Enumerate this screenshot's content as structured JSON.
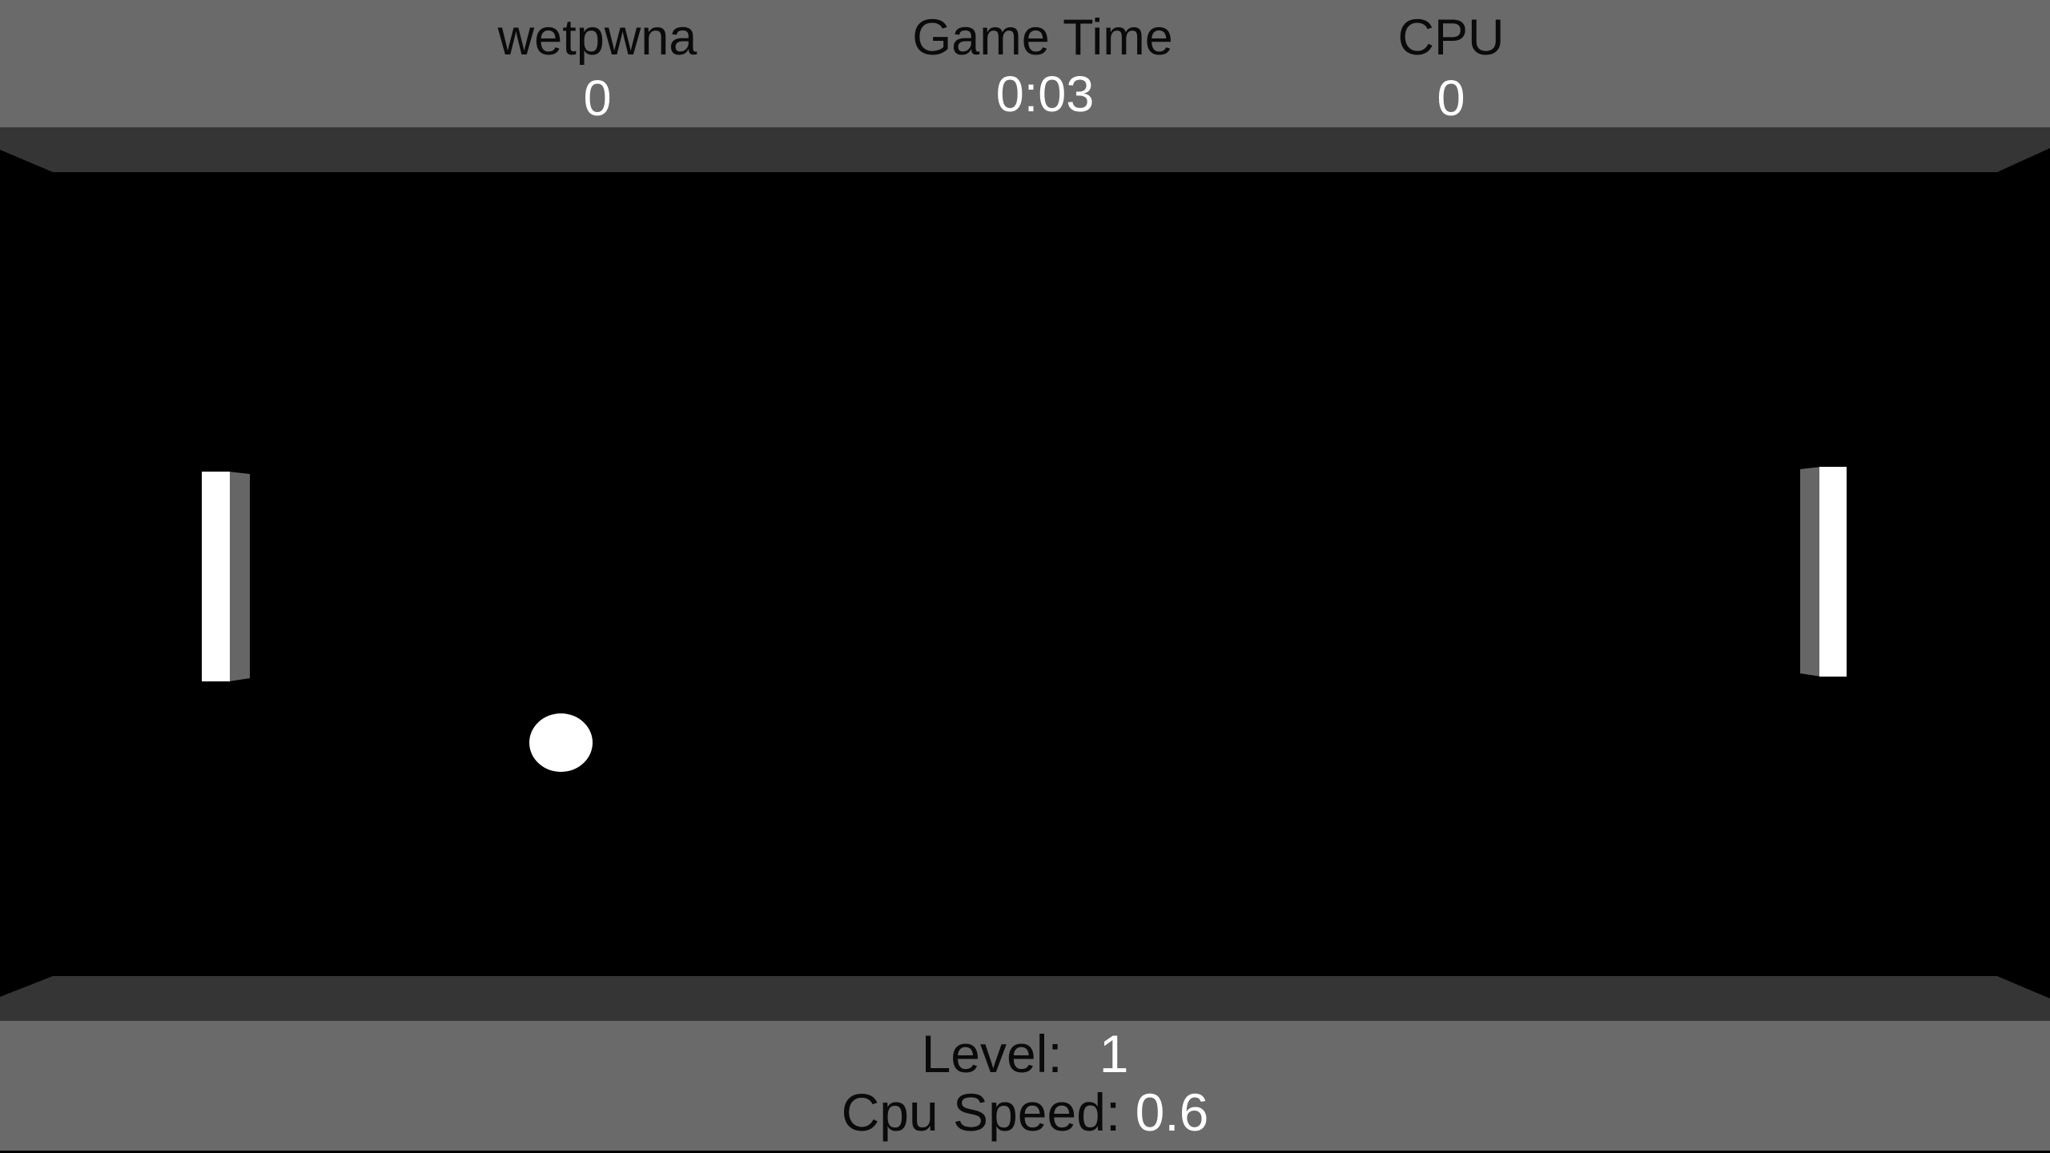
{
  "hud": {
    "player": {
      "name": "wetpwna",
      "score": "0"
    },
    "timer": {
      "label": "Game Time",
      "value": "0:03"
    },
    "opponent": {
      "name": "CPU",
      "score": "0"
    }
  },
  "footer": {
    "level_label": "Level:",
    "level_value": "1",
    "cpu_speed_label": "Cpu Speed:",
    "cpu_speed_value": "0.6"
  },
  "colors": {
    "hud_background": "#6a6a6a",
    "wall": "#353535",
    "field": "#000000",
    "paddle_face": "#ffffff",
    "paddle_side": "#666666",
    "ball": "#ffffff",
    "label_text": "#0a0a0a",
    "value_text": "#ffffff"
  }
}
